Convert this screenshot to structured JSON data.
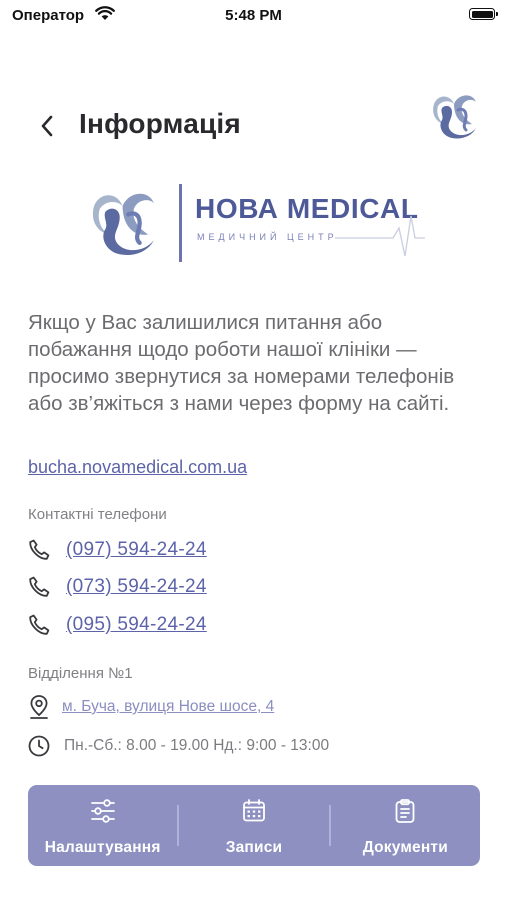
{
  "status_bar": {
    "carrier": "Оператор",
    "time": "5:48 PM",
    "battery_level": 1.0
  },
  "header": {
    "title": "Інформація",
    "back_icon": "chevron-left-icon",
    "logo_icon": "nova-medical-emblem"
  },
  "brand": {
    "name": "НОВА MEDICAL",
    "subtitle": "МЕДИЧНИЙ ЦЕНТР",
    "logo_icon": "nova-medical-emblem"
  },
  "intro_text": "Якщо у Вас залишилися питання або побажання щодо роботи нашої клініки — просимо звернутися за номерами телефонів або зв’яжіться з нами через форму на сайті.",
  "website": "bucha.novamedical.com.ua",
  "contacts": {
    "label": "Контактні телефони",
    "phones": [
      "(097) 594-24-24",
      "(073) 594-24-24",
      "(095) 594-24-24"
    ],
    "icon": "phone-icon"
  },
  "branch": {
    "label": "Відділення №1",
    "address": "м. Буча, вулиця Нове шосе, 4",
    "address_icon": "location-pin-icon",
    "hours": "Пн.-Сб.: 8.00 - 19.00 Нд.: 9:00 - 13:00",
    "hours_icon": "clock-icon"
  },
  "tab_bar": {
    "background": "#8d90c1",
    "items": [
      {
        "label": "Налаштування",
        "icon": "settings-sliders-icon"
      },
      {
        "label": "Записи",
        "icon": "calendar-icon"
      },
      {
        "label": "Документи",
        "icon": "clipboard-icon"
      }
    ]
  },
  "colors": {
    "accent": "#5d63a8",
    "brand": "#4e5a97"
  }
}
